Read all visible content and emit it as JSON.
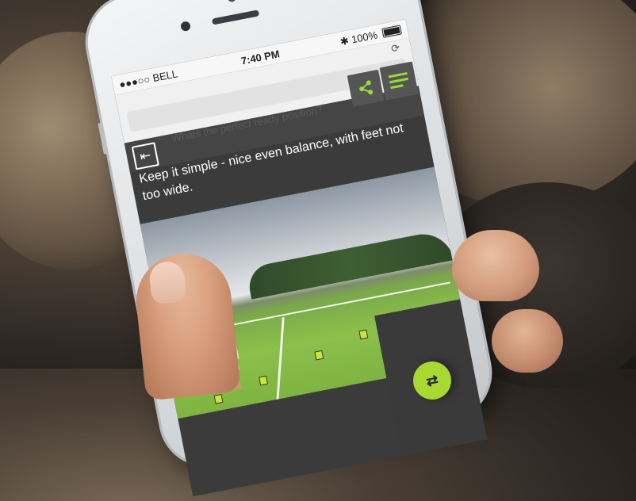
{
  "status_bar": {
    "carrier": "●●●○○ BELL",
    "time": "7:40 PM",
    "battery": "100%"
  },
  "browser": {
    "reload_icon": "reload-icon"
  },
  "header": {
    "share_icon": "share-icon",
    "menu_icon": "menu-icon",
    "background_text": "Whats the perfect ready position?"
  },
  "lesson": {
    "exit_icon": "exit-icon",
    "caption": "Keep it simple - nice even balance, with feet not too wide."
  },
  "player_controls": {
    "swap_icon": "swap-icon",
    "accent_color": "#a8d933"
  }
}
